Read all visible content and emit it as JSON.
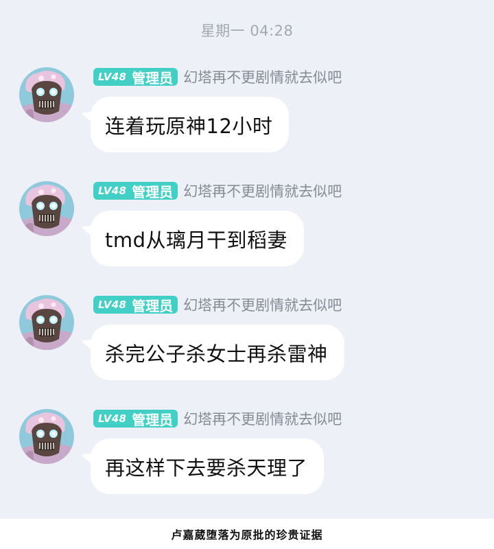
{
  "timestamp": "星期一 04:28",
  "sender": {
    "level_badge": "LV48",
    "role": "管理员",
    "nickname": "幻塔再不更剧情就去似吧",
    "avatar_icon": "masked-character-avatar"
  },
  "messages": [
    {
      "text": "连着玩原神12小时"
    },
    {
      "text": "tmd从璃月干到稻妻"
    },
    {
      "text": "杀完公子杀女士再杀雷神"
    },
    {
      "text": "再这样下去要杀天理了"
    }
  ],
  "caption": "卢嘉葳堕落为原批的珍贵证据",
  "colors": {
    "chat_background": "#eef0f8",
    "badge": "#42d0c6",
    "bubble": "#ffffff",
    "nickname": "#868a95",
    "timestamp": "#a4a8b3"
  }
}
